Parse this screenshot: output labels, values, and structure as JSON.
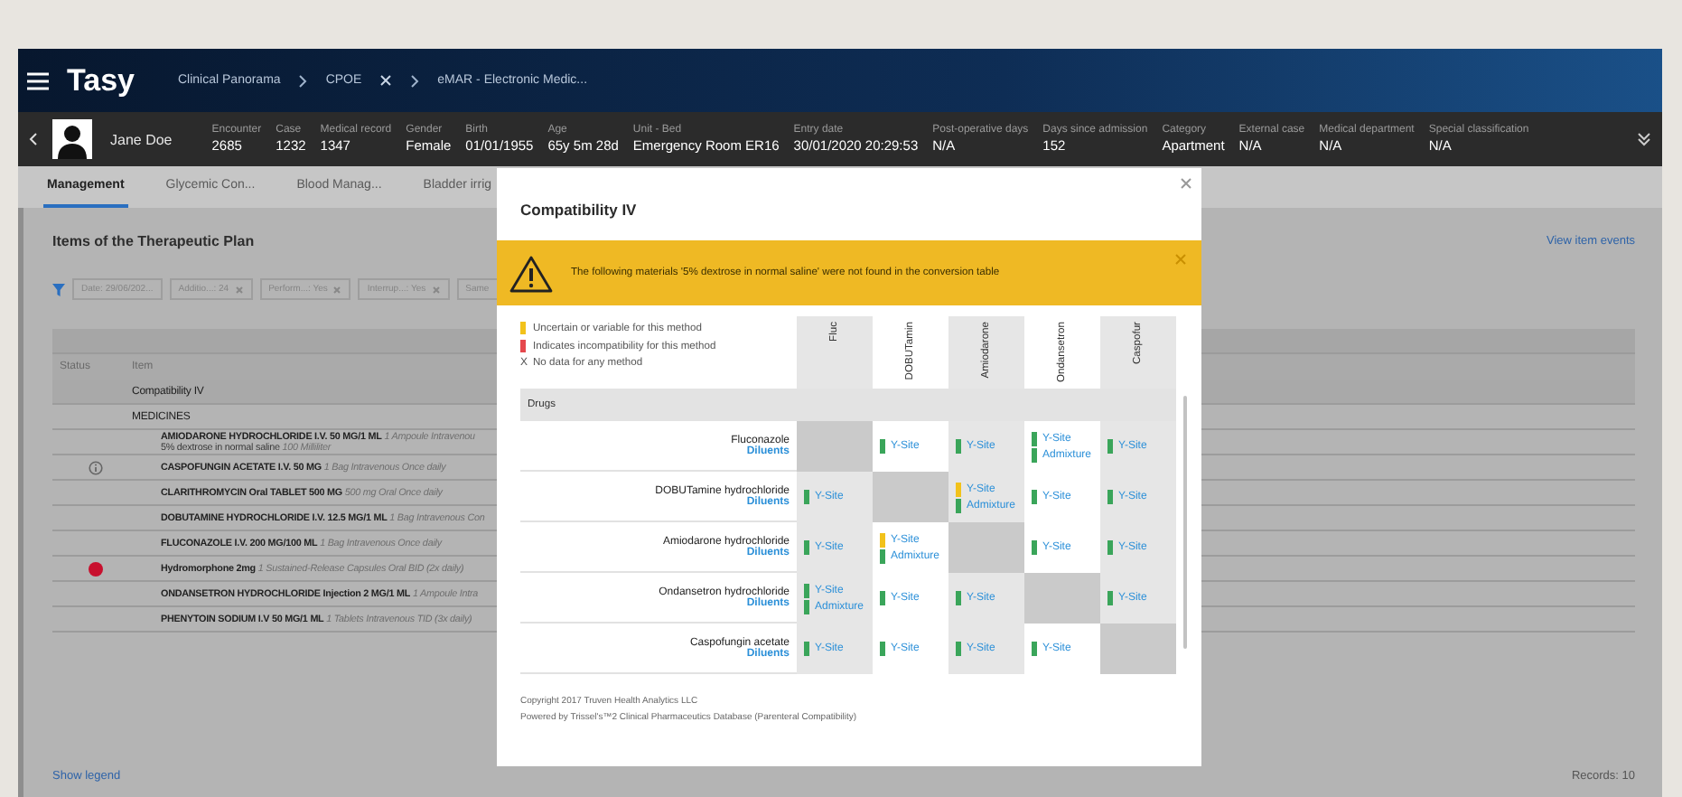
{
  "header": {
    "app_title": "Tasy",
    "breadcrumbs": [
      {
        "label": "Clinical Panorama",
        "closable": false
      },
      {
        "label": "CPOE",
        "closable": true
      },
      {
        "label": "eMAR - Electronic Medic...",
        "closable": false
      }
    ]
  },
  "patient": {
    "name": "Jane Doe",
    "fields": [
      {
        "label": "Encounter",
        "value": "2685"
      },
      {
        "label": "Case",
        "value": "1232"
      },
      {
        "label": "Medical record",
        "value": "1347"
      },
      {
        "label": "Gender",
        "value": "Female"
      },
      {
        "label": "Birth",
        "value": "01/01/1955"
      },
      {
        "label": "Age",
        "value": "65y 5m 28d"
      },
      {
        "label": "Unit - Bed",
        "value": "Emergency Room ER16"
      },
      {
        "label": "Entry date",
        "value": "30/01/2020 20:29:53"
      },
      {
        "label": "Post-operative days",
        "value": "N/A"
      },
      {
        "label": "Days since admission",
        "value": "152"
      },
      {
        "label": "Category",
        "value": "Apartment"
      },
      {
        "label": "External case",
        "value": "N/A"
      },
      {
        "label": "Medical department",
        "value": "N/A"
      },
      {
        "label": "Special classification",
        "value": "N/A"
      }
    ]
  },
  "tabs": [
    {
      "label": "Management",
      "selected": true
    },
    {
      "label": "Glycemic Con...",
      "selected": false
    },
    {
      "label": "Blood Manag...",
      "selected": false
    },
    {
      "label": "Bladder irrig",
      "selected": false
    }
  ],
  "plan": {
    "title": "Items of the Therapeutic Plan",
    "view_events_link": "View item events",
    "filters": [
      {
        "label": "Date: 29/06/202...",
        "removable": false
      },
      {
        "label": "Additio...: 24",
        "removable": true
      },
      {
        "label": "Perform...: Yes",
        "removable": true
      },
      {
        "label": "Interrup...: Yes",
        "removable": true
      },
      {
        "label": "Same",
        "removable": false
      }
    ],
    "columns": [
      "Status",
      "Item"
    ],
    "rows": [
      {
        "kind": "group",
        "name": "Compatibility IV"
      },
      {
        "kind": "section",
        "name": "MEDICINES"
      },
      {
        "kind": "medicine",
        "name": "AMIODARONE HYDROCHLORIDE I.V. 50 MG/1 ML",
        "detail": "1 Ampoule Intravenou",
        "sub_name": "5% dextrose in normal saline",
        "sub_detail": "100 Milliliter"
      },
      {
        "kind": "info",
        "name": "CASPOFUNGIN ACETATE I.V. 50 MG",
        "detail": "1 Bag Intravenous Once daily"
      },
      {
        "kind": "medicine",
        "name": "CLARITHROMYCIN Oral TABLET 500 MG",
        "detail": "500 mg Oral Once daily"
      },
      {
        "kind": "medicine",
        "name": "DOBUTAMINE HYDROCHLORIDE I.V. 12.5 MG/1 ML",
        "detail": "1 Bag Intravenous Con"
      },
      {
        "kind": "medicine",
        "name": "FLUCONAZOLE I.V. 200 MG/100 ML",
        "detail": "1 Bag Intravenous Once daily"
      },
      {
        "kind": "alert",
        "name": "Hydromorphone 2mg",
        "detail": "1 Sustained-Release Capsules Oral BID (2x daily)"
      },
      {
        "kind": "medicine",
        "name": "ONDANSETRON HYDROCHLORIDE Injection 2 MG/1 ML",
        "detail": "1 Ampoule Intra"
      },
      {
        "kind": "medicine",
        "name": "PHENYTOIN SODIUM I.V 50 MG/1 ML",
        "detail": "1 Tablets Intravenous TID (3x daily)"
      }
    ],
    "show_legend": "Show legend",
    "records": "Records: 10"
  },
  "modal": {
    "title": "Compatibility IV",
    "warning": "The following materials '5% dextrose in normal saline' were not found in the conversion table",
    "legend": [
      {
        "kind": "swatch",
        "color": "#f2c21b",
        "text": "Uncertain or variable for this method"
      },
      {
        "kind": "swatch",
        "color": "#e5484d",
        "text": "Indicates incompatibility for this method"
      },
      {
        "kind": "mark",
        "symbol": "X",
        "text": "No data for any method"
      }
    ],
    "columns": [
      "Fluc",
      "DOBUTamin",
      "Amiodarone",
      "Ondansetron",
      "Caspofur"
    ],
    "section": "Drugs",
    "rows": [
      {
        "drug": "Fluconazole",
        "link": "Diluents",
        "cells": [
          [],
          [
            {
              "label": "Y-Site",
              "color": "#3aa55a"
            }
          ],
          [
            {
              "label": "Y-Site",
              "color": "#3aa55a"
            }
          ],
          [
            {
              "label": "Y-Site",
              "color": "#3aa55a"
            },
            {
              "label": "Admixture",
              "color": "#3aa55a"
            }
          ],
          [
            {
              "label": "Y-Site",
              "color": "#3aa55a"
            }
          ]
        ]
      },
      {
        "drug": "DOBUTamine hydrochloride",
        "link": "Diluents",
        "cells": [
          [
            {
              "label": "Y-Site",
              "color": "#3aa55a"
            }
          ],
          [],
          [
            {
              "label": "Y-Site",
              "color": "#f2c21b"
            },
            {
              "label": "Admixture",
              "color": "#3aa55a"
            }
          ],
          [
            {
              "label": "Y-Site",
              "color": "#3aa55a"
            }
          ],
          [
            {
              "label": "Y-Site",
              "color": "#3aa55a"
            }
          ]
        ]
      },
      {
        "drug": "Amiodarone hydrochloride",
        "link": "Diluents",
        "cells": [
          [
            {
              "label": "Y-Site",
              "color": "#3aa55a"
            }
          ],
          [
            {
              "label": "Y-Site",
              "color": "#f2c21b"
            },
            {
              "label": "Admixture",
              "color": "#3aa55a"
            }
          ],
          [],
          [
            {
              "label": "Y-Site",
              "color": "#3aa55a"
            }
          ],
          [
            {
              "label": "Y-Site",
              "color": "#3aa55a"
            }
          ]
        ]
      },
      {
        "drug": "Ondansetron hydrochloride",
        "link": "Diluents",
        "cells": [
          [
            {
              "label": "Y-Site",
              "color": "#3aa55a"
            },
            {
              "label": "Admixture",
              "color": "#3aa55a"
            }
          ],
          [
            {
              "label": "Y-Site",
              "color": "#3aa55a"
            }
          ],
          [
            {
              "label": "Y-Site",
              "color": "#3aa55a"
            }
          ],
          [],
          [
            {
              "label": "Y-Site",
              "color": "#3aa55a"
            }
          ]
        ]
      },
      {
        "drug": "Caspofungin acetate",
        "link": "Diluents",
        "cells": [
          [
            {
              "label": "Y-Site",
              "color": "#3aa55a"
            }
          ],
          [
            {
              "label": "Y-Site",
              "color": "#3aa55a"
            }
          ],
          [
            {
              "label": "Y-Site",
              "color": "#3aa55a"
            }
          ],
          [
            {
              "label": "Y-Site",
              "color": "#3aa55a"
            }
          ],
          []
        ]
      }
    ],
    "copyright": [
      "Copyright 2017 Truven Health Analytics LLC",
      "Powered by Trissel's™2 Clinical Pharmaceutics Database (Parenteral Compatibility)"
    ]
  }
}
